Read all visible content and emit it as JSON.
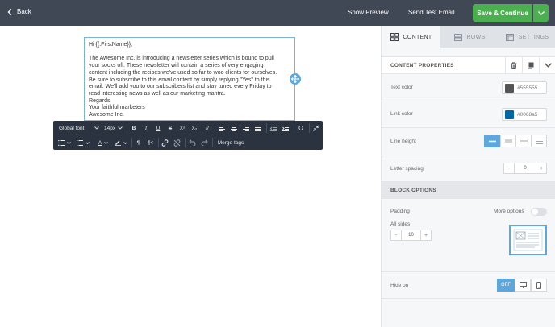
{
  "topbar": {
    "back_label": "Back",
    "show_preview_label": "Show Preview",
    "send_test_label": "Send Test Email",
    "save_label": "Save & Continue"
  },
  "editor": {
    "lines": [
      "Hi {{.FirstName}},",
      "",
      "The Awesome Inc. is introducing a newsletter series which is bound to pull",
      "your socks off. These newsletter will contain a series of very engaging",
      "content including the recipes we've used so far to woo clients for ourselves.",
      "Be sure to subscribe to this email content by simply replying \"Yes\" to this",
      "email. We'll add you to our subscribers list and stay tuned every Friday to",
      "read interesting news as well as our marketing mantra.",
      "Regards",
      "Your faithful marketers",
      "Awesome Inc."
    ]
  },
  "toolbar": {
    "font_family": "Global font",
    "font_size": "14px",
    "merge_tags_label": "Merge tags"
  },
  "panel": {
    "tabs": [
      {
        "label": "CONTENT",
        "icon": "grid-icon"
      },
      {
        "label": "ROWS",
        "icon": "rows-icon"
      },
      {
        "label": "SETTINGS",
        "icon": "settings-icon"
      }
    ],
    "content_properties_title": "CONTENT PROPERTIES",
    "text_color_label": "Text color",
    "text_color_value": "#555555",
    "link_color_label": "Link color",
    "link_color_value": "#0068a5",
    "line_height_label": "Line height",
    "letter_spacing_label": "Letter spacing",
    "letter_spacing_value": "0",
    "block_options_title": "BLOCK OPTIONS",
    "padding_label": "Padding",
    "more_options_label": "More options",
    "all_sides_label": "All sides",
    "padding_value": "10",
    "hide_on_label": "Hide on",
    "hide_on_off_label": "OFF"
  },
  "colors": {
    "accent": "#5ca7dd",
    "save_green": "#4bae4f",
    "topbar": "#404856",
    "toolbar": "#2b3340"
  }
}
